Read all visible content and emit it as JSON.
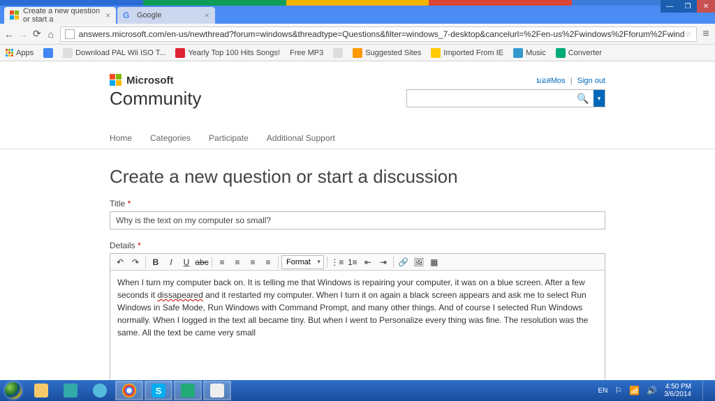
{
  "window": {
    "controls": [
      "—",
      "❐",
      "✕"
    ]
  },
  "tabs": [
    {
      "title": "Create a new question or start a",
      "active": true
    },
    {
      "title": "Google",
      "active": false
    }
  ],
  "omnibox": {
    "url": "answers.microsoft.com/en-us/newthread?forum=windows&threadtype=Questions&filter=windows_7-desktop&cancelurl=%2Fen-us%2Fwindows%2Fforum%2Fwind"
  },
  "bookmarks": [
    "Apps",
    "",
    "Download PAL Wii ISO T...",
    "Yearly Top 100 Hits Songs!",
    "Free MP3",
    "",
    "Suggested Sites",
    "Imported From IE",
    "Music",
    "Converter"
  ],
  "header": {
    "brand": "Microsoft",
    "product": "Community",
    "user": "มอสMos",
    "signout": "Sign out"
  },
  "nav": [
    "Home",
    "Categories",
    "Participate",
    "Additional Support"
  ],
  "page_heading": "Create a new question or start a discussion",
  "form": {
    "title_label": "Title",
    "title_value": "Why is the text on my computer so small?",
    "details_label": "Details",
    "format_label": "Format",
    "details_value_pre": "When I turn my computer back on. It is telling me that Windows is repairing your computer, it was on a blue screen. After a few seconds it ",
    "details_typo": "dissapeared",
    "details_value_post": " and it restarted my computer. When I turn it on again a black screen appears and ask me to select Run Windows in Safe Mode, Run Windows with Command Prompt, and many other things. And of course I selected Run Windows normally. When I logged in the text all became tiny. But when I went to Personalize every thing was fine. The resolution was the same. All the text be came very small"
  },
  "taskbar": {
    "lang": "EN",
    "time": "4:50 PM",
    "date": "3/6/2014"
  }
}
